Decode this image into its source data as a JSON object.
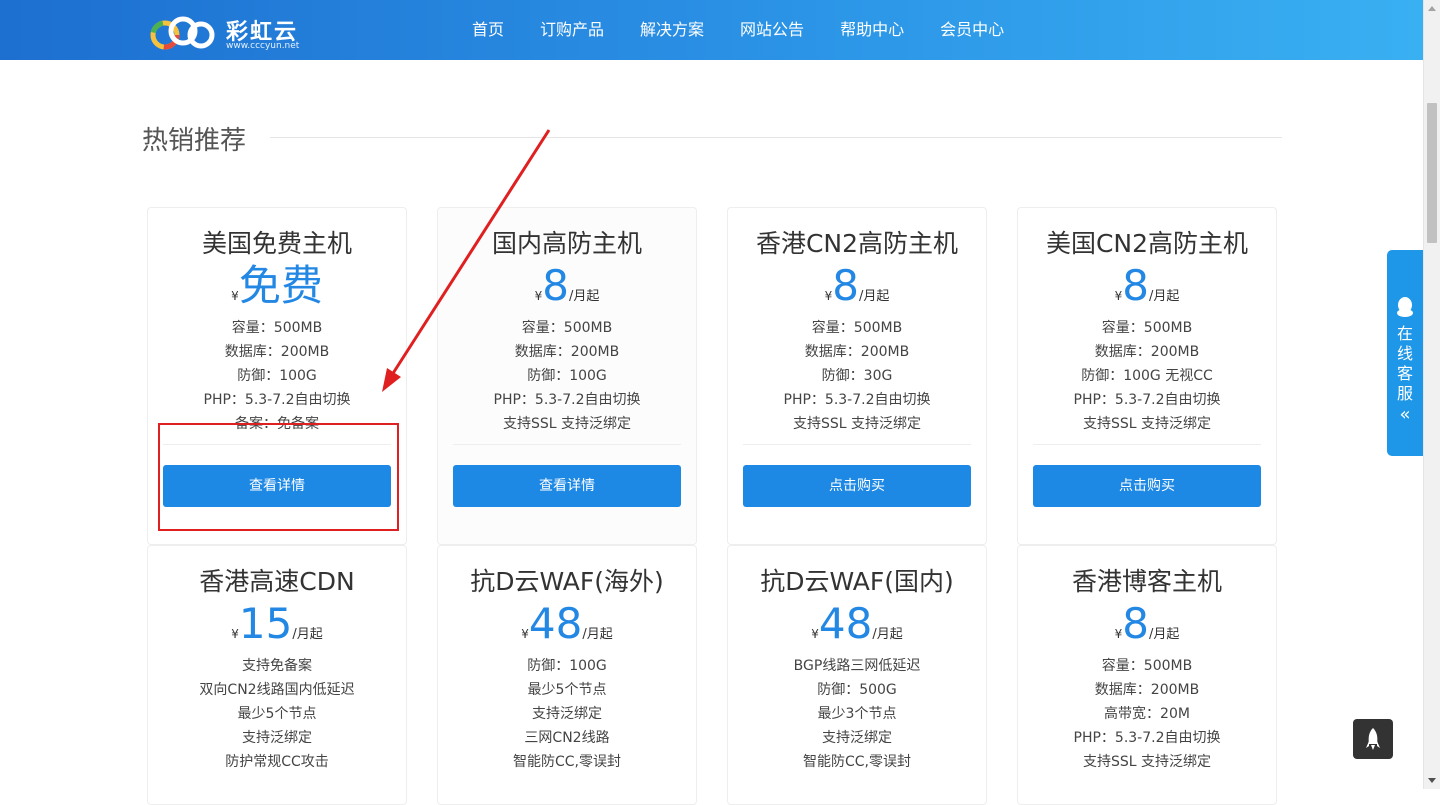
{
  "header": {
    "logo_name": "彩虹云",
    "logo_url": "www.cccyun.net",
    "nav": [
      "首页",
      "订购产品",
      "解决方案",
      "网站公告",
      "帮助中心",
      "会员中心"
    ]
  },
  "section": {
    "title": "热销推荐"
  },
  "products": [
    {
      "title": "美国免费主机",
      "currency": "¥",
      "price": "免费",
      "unit": "",
      "features": [
        "容量：500MB",
        "数据库：200MB",
        "防御：100G",
        "PHP：5.3-7.2自由切换",
        "备案：免备案"
      ],
      "button": "查看详情"
    },
    {
      "title": "国内高防主机",
      "currency": "¥",
      "price": "8",
      "unit": "/月起",
      "features": [
        "容量：500MB",
        "数据库：200MB",
        "防御：100G",
        "PHP：5.3-7.2自由切换",
        "支持SSL 支持泛绑定"
      ],
      "button": "查看详情"
    },
    {
      "title": "香港CN2高防主机",
      "currency": "¥",
      "price": "8",
      "unit": "/月起",
      "features": [
        "容量：500MB",
        "数据库：200MB",
        "防御：30G",
        "PHP：5.3-7.2自由切换",
        "支持SSL 支持泛绑定"
      ],
      "button": "点击购买"
    },
    {
      "title": "美国CN2高防主机",
      "currency": "¥",
      "price": "8",
      "unit": "/月起",
      "features": [
        "容量：500MB",
        "数据库：200MB",
        "防御：100G 无视CC",
        "PHP：5.3-7.2自由切换",
        "支持SSL 支持泛绑定"
      ],
      "button": "点击购买"
    },
    {
      "title": "香港高速CDN",
      "currency": "¥",
      "price": "15",
      "unit": "/月起",
      "features": [
        "支持免备案",
        "双向CN2线路国内低延迟",
        "最少5个节点",
        "支持泛绑定",
        "防护常规CC攻击"
      ],
      "button": ""
    },
    {
      "title": "抗D云WAF(海外)",
      "currency": "¥",
      "price": "48",
      "unit": "/月起",
      "features": [
        "防御：100G",
        "最少5个节点",
        "支持泛绑定",
        "三网CN2线路",
        "智能防CC,零误封"
      ],
      "button": ""
    },
    {
      "title": "抗D云WAF(国内)",
      "currency": "¥",
      "price": "48",
      "unit": "/月起",
      "features": [
        "BGP线路三网低延迟",
        "防御：500G",
        "最少3个节点",
        "支持泛绑定",
        "智能防CC,零误封"
      ],
      "button": ""
    },
    {
      "title": "香港博客主机",
      "currency": "¥",
      "price": "8",
      "unit": "/月起",
      "features": [
        "容量：500MB",
        "数据库：200MB",
        "高带宽：20M",
        "PHP：5.3-7.2自由切换",
        "支持SSL 支持泛绑定"
      ],
      "button": ""
    }
  ],
  "widgets": {
    "kefu_text": "在线客服",
    "kefu_chevron": "«"
  },
  "colors": {
    "accent": "#1e88e5",
    "price": "#2387e4",
    "annotation": "#e02020"
  }
}
